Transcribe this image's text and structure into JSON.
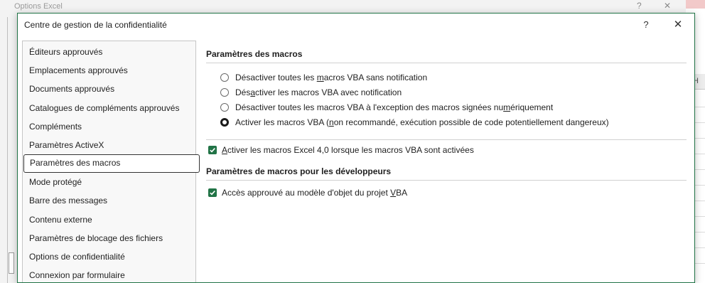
{
  "background": {
    "parent_title": "Options Excel",
    "min_glyph": "?",
    "close_glyph": "✕",
    "sheet_col": "H"
  },
  "dialog": {
    "title": "Centre de gestion de la confidentialité",
    "help_label": "?",
    "close_label": "✕"
  },
  "nav": {
    "items": [
      "Éditeurs approuvés",
      "Emplacements approuvés",
      "Documents approuvés",
      "Catalogues de compléments approuvés",
      "Compléments",
      "Paramètres ActiveX",
      "Paramètres des macros",
      "Mode protégé",
      "Barre des messages",
      "Contenu externe",
      "Paramètres de blocage des fichiers",
      "Options de confidentialité",
      "Connexion par formulaire"
    ],
    "selected_index": 6
  },
  "macro_settings": {
    "title": "Paramètres des macros",
    "options": [
      {
        "pre": "Désactiver toutes les ",
        "u": "m",
        "post": "acros VBA sans notification",
        "checked": false
      },
      {
        "pre": "Dés",
        "u": "a",
        "post": "ctiver les macros VBA avec notification",
        "checked": false
      },
      {
        "pre": "Désactiver toutes les macros VBA à l'exception des macros signées nu",
        "u": "m",
        "post": "ériquement",
        "checked": false
      },
      {
        "pre": "Activer les macros VBA (",
        "u": "n",
        "post": "on recommandé, exécution possible de code potentiellement dangereux)",
        "checked": true
      }
    ],
    "excel4": {
      "pre": "",
      "u": "A",
      "post": "ctiver les macros Excel 4,0 lorsque les macros VBA sont activées",
      "checked": true
    }
  },
  "developer_settings": {
    "title": "Paramètres de macros pour les développeurs",
    "vba_access": {
      "pre": "Accès approuvé au modèle d'objet du projet ",
      "u": "V",
      "post": "BA",
      "checked": true
    }
  },
  "colors": {
    "accent": "#217346",
    "selected_border": "#333333"
  }
}
